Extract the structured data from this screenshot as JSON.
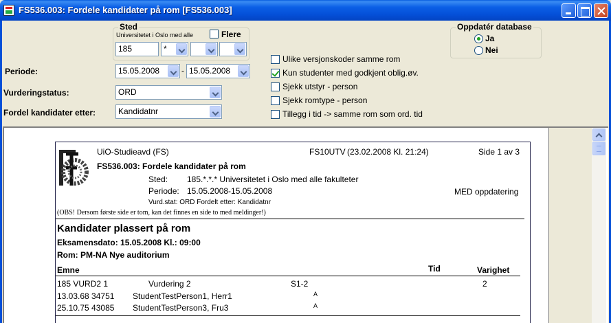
{
  "window": {
    "title": "FS536.003: Fordele kandidater på rom  [FS536.003]"
  },
  "sted": {
    "group_title": "Sted",
    "org_name": "Universitetet i Oslo med alle",
    "flere_label": "Flere",
    "code_value": "185",
    "combo1_value": "*",
    "combo2_value": "",
    "combo3_value": ""
  },
  "oppdater": {
    "group_title": "Oppdatér database",
    "ja_label": "Ja",
    "nei_label": "Nei",
    "selected": "Ja"
  },
  "periode": {
    "label": "Periode:",
    "from": "15.05.2008",
    "separator": "-",
    "to": "15.05.2008"
  },
  "vurderingstatus": {
    "label": "Vurderingstatus:",
    "value": "ORD"
  },
  "fordel": {
    "label": "Fordel kandidater etter:",
    "value": "Kandidatnr"
  },
  "options": [
    {
      "label": "Ulike versjonskoder samme rom",
      "checked": false
    },
    {
      "label": "Kun studenter med godkjent oblig.øv.",
      "checked": true
    },
    {
      "label": "Sjekk utstyr - person",
      "checked": false
    },
    {
      "label": "Sjekk romtype - person",
      "checked": false
    },
    {
      "label": "Tillegg i tid -> samme rom som ord. tid",
      "checked": false
    }
  ],
  "report": {
    "org": "UiO-Studieavd (FS)",
    "report_code": "FS10UTV",
    "timestamp": "(23.02.2008 Kl. 21:24)",
    "page_info": "Side 1 av 3",
    "heading": "FS536.003: Fordele kandidater på rom",
    "sted_label": "Sted:",
    "sted_value": "185.*.*.* Universitetet i Oslo med alle fakulteter",
    "periode_label": "Periode:",
    "periode_value": "15.05.2008-15.05.2008",
    "update_mode": "MED oppdatering",
    "vurd_line": "Vurd.stat: ORD Fordelt etter: Kandidatnr",
    "note": "(OBS! Dersom første side er tom, kan det finnes en side to med meldinger!)",
    "section_title": "Kandidater plassert på rom",
    "exam_date": "Eksamensdato: 15.05.2008 Kl.: 09:00",
    "room": "Rom: PM-NA Nye auditorium",
    "col_emne": "Emne",
    "col_tid": "Tid",
    "col_varighet": "Varighet",
    "row1": {
      "code": "185 VURD2 1",
      "name": "Vurdering 2",
      "slot": "S1-2",
      "varighet": "2"
    },
    "students": [
      {
        "id": "13.03.68 34751",
        "name": "StudentTestPerson1, Herr1",
        "mark": "A"
      },
      {
        "id": "25.10.75 43085",
        "name": "StudentTestPerson3, Fru3",
        "mark": "A"
      }
    ]
  },
  "icons": [
    "app-icon",
    "minimize-icon",
    "maximize-icon",
    "close-icon",
    "chevron-down-icon",
    "scroll-up-icon",
    "fs-logo"
  ]
}
